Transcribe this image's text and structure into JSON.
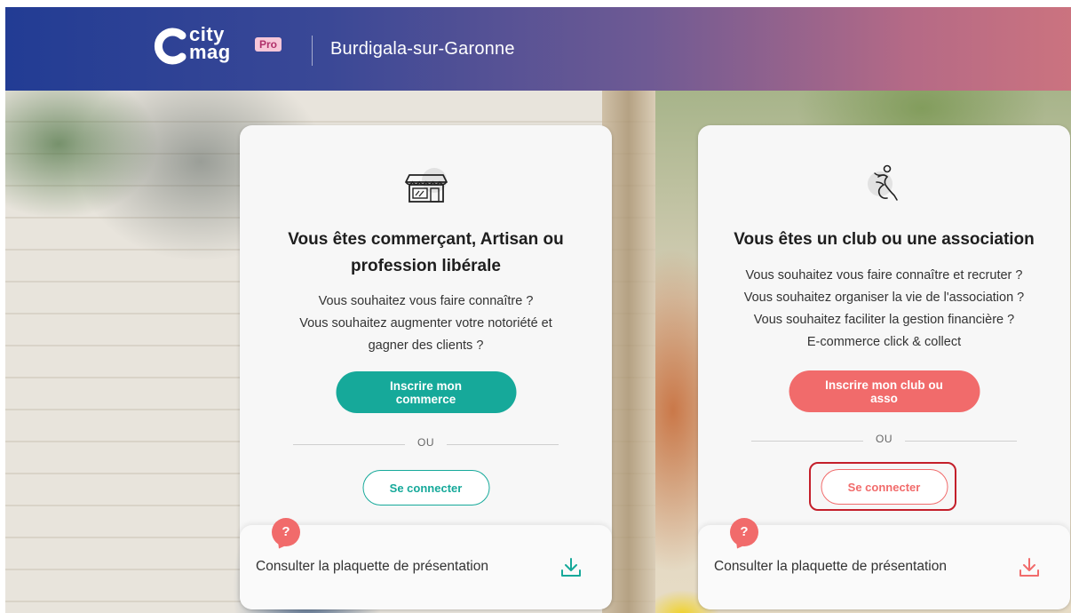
{
  "header": {
    "logo_city": "city",
    "logo_mag": "mag",
    "logo_pro": "Pro",
    "city_name": "Burdigala-sur-Garonne"
  },
  "cards": [
    {
      "title_line1": "Vous êtes commerçant, Artisan ou",
      "title_line2": "profession libérale",
      "desc": [
        "Vous souhaitez vous faire connaître ?",
        "Vous souhaitez augmenter votre notoriété et",
        "gagner des clients ?"
      ],
      "primary_button": "Inscrire mon commerce",
      "or_label": "OU",
      "login_button": "Se connecter",
      "help": "?",
      "brochure_label": "Consulter la plaquette de présentation",
      "icon": "shop-icon",
      "accent": "#16a99a"
    },
    {
      "title_line1": "Vous êtes un club ou une association",
      "desc": [
        "Vous souhaitez vous faire connaître et recruter ?",
        "Vous souhaitez organiser la vie de l'association ?",
        "Vous souhaitez faciliter la gestion financière ?",
        "E-commerce click & collect"
      ],
      "primary_button": "Inscrire mon club ou asso",
      "or_label": "OU",
      "login_button": "Se connecter",
      "help": "?",
      "brochure_label": "Consulter la plaquette de présentation",
      "icon": "runner-icon",
      "accent": "#f16b6b"
    }
  ],
  "colors": {
    "header_start": "#223c94",
    "header_end": "#cb737f",
    "highlight": "#c41f2a"
  }
}
